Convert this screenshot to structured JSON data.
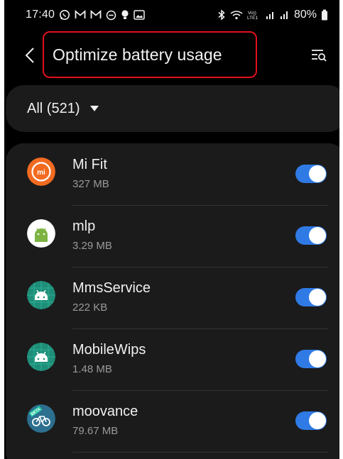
{
  "status_bar": {
    "time": "17:40",
    "left_icons": [
      "whatsapp-icon",
      "gmail-icon",
      "gmail-icon",
      "do-not-disturb-icon",
      "bulb-icon",
      "gallery-icon"
    ],
    "right_icons": [
      "bluetooth-icon",
      "wifi-icon",
      "volte-icon",
      "signal-icon",
      "signal-icon",
      "battery-icon"
    ],
    "volte_label": "Vo)) LTE1",
    "battery_percent": "80%"
  },
  "header": {
    "title": "Optimize battery usage",
    "back_icon": "chevron-left-icon",
    "search_icon": "search-list-icon",
    "highlight_color": "#e0101b"
  },
  "filter": {
    "label": "All (521)",
    "icon": "caret-down-icon"
  },
  "apps": [
    {
      "name": "Mi Fit",
      "size": "327 MB",
      "icon": "mi-fit-icon",
      "enabled": true
    },
    {
      "name": "mlp",
      "size": "3.29 MB",
      "icon": "android-icon",
      "enabled": true
    },
    {
      "name": "MmsService",
      "size": "222 KB",
      "icon": "android-teal-icon",
      "enabled": true
    },
    {
      "name": "MobileWips",
      "size": "1.48 MB",
      "icon": "android-teal-icon",
      "enabled": true
    },
    {
      "name": "moovance",
      "size": "79.67 MB",
      "icon": "moovance-icon",
      "badge": "BETA",
      "enabled": true
    }
  ],
  "colors": {
    "background": "#000000",
    "card": "#1b1b1b",
    "toggle_on": "#2f7ae5",
    "secondary_text": "#9a9a9a"
  }
}
